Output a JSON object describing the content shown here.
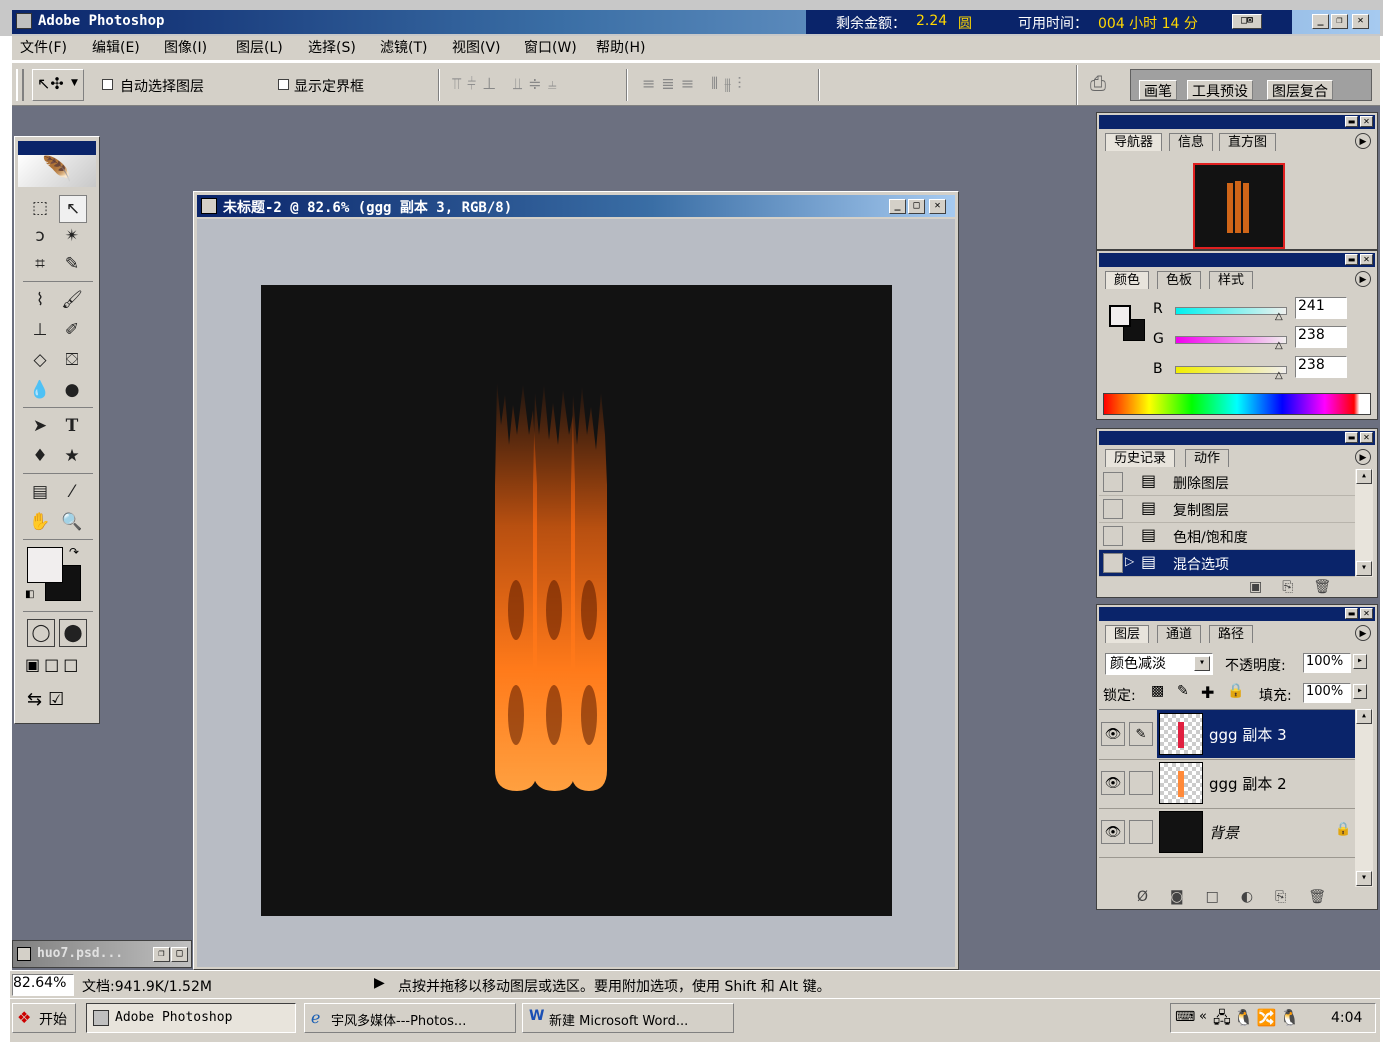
{
  "app": {
    "title": "Adobe Photoshop",
    "balance_label": "剩余金额：",
    "balance_value": "2.24",
    "balance_unit": "圆",
    "time_label": "可用时间：",
    "time_value": "004 小时 14 分"
  },
  "menu": [
    "文件(F)",
    "编辑(E)",
    "图像(I)",
    "图层(L)",
    "选择(S)",
    "滤镜(T)",
    "视图(V)",
    "窗口(W)",
    "帮助(H)"
  ],
  "options": {
    "auto_select": "自动选择图层",
    "show_bounds": "显示定界框"
  },
  "palette_well": [
    "画笔",
    "工具预设",
    "图层复合"
  ],
  "document": {
    "title": "未标题-2 @ 82.6% (ggg 副本 3, RGB/8)",
    "minimized_title": "huo7.psd..."
  },
  "navigator": {
    "tabs": [
      "导航器",
      "信息",
      "直方图"
    ]
  },
  "color": {
    "tabs": [
      "颜色",
      "色板",
      "样式"
    ],
    "r_label": "R",
    "g_label": "G",
    "b_label": "B",
    "r": "241",
    "g": "238",
    "b": "238"
  },
  "history": {
    "tabs": [
      "历史记录",
      "动作"
    ],
    "items": [
      "删除图层",
      "复制图层",
      "色相/饱和度",
      "混合选项"
    ]
  },
  "layers": {
    "tabs": [
      "图层",
      "通道",
      "路径"
    ],
    "blend_mode": "颜色减淡",
    "opacity_label": "不透明度:",
    "opacity": "100%",
    "lock_label": "锁定:",
    "fill_label": "填充:",
    "fill": "100%",
    "items": [
      "ggg 副本 3",
      "ggg 副本 2",
      "背景"
    ]
  },
  "status": {
    "zoom": "82.64%",
    "doc_size": "文档:941.9K/1.52M",
    "hint": "点按并拖移以移动图层或选区。要用附加选项，使用 Shift 和 Alt 键。"
  },
  "taskbar": {
    "start": "开始",
    "tasks": [
      "Adobe Photoshop",
      "宇风多媒体---Photos...",
      "新建 Microsoft Word..."
    ],
    "clock": "4:04"
  },
  "colors": {
    "title_blue": "#0a246a",
    "workspace": "#6c7080",
    "canvas": "#121212",
    "flame": "#ff7a1a"
  }
}
